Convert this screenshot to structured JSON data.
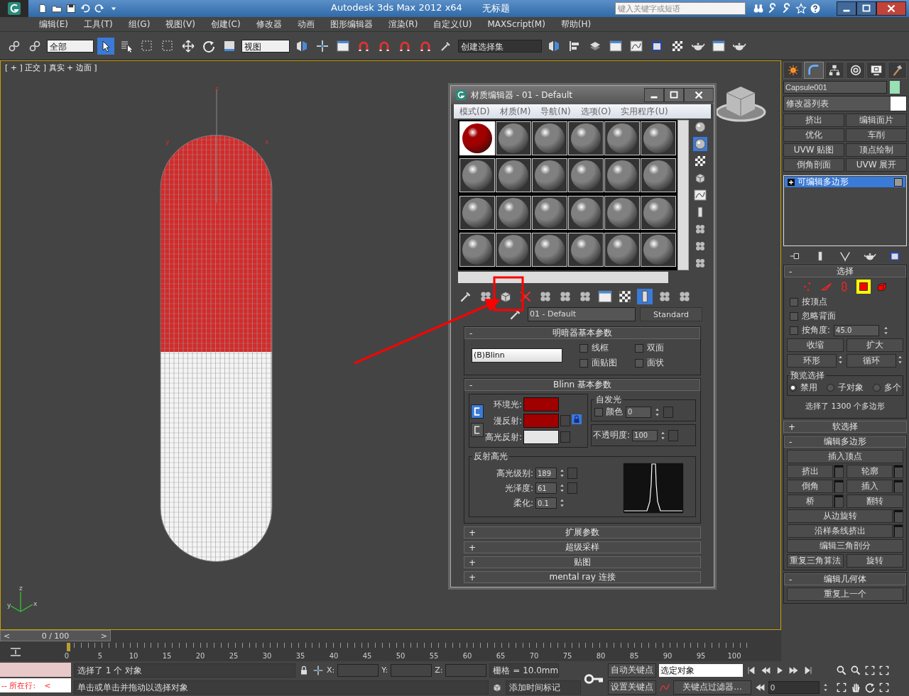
{
  "title_bar": {
    "app_title": "Autodesk 3ds Max  2012 x64",
    "document": "无标题",
    "search_placeholder": "键入关键字或短语"
  },
  "menu": [
    "编辑(E)",
    "工具(T)",
    "组(G)",
    "视图(V)",
    "创建(C)",
    "修改器",
    "动画",
    "图形编辑器",
    "渲染(R)",
    "自定义(U)",
    "MAXScript(M)",
    "帮助(H)"
  ],
  "main_toolbar": {
    "selection_filter": "全部",
    "reference_coord": "视图",
    "named_selection": "创建选择集"
  },
  "viewport": {
    "label": "[ + ] 正交 ] 真实 + 边面 ]",
    "object_axis_labels": [
      "z",
      "y",
      "x"
    ],
    "world_axis_labels": [
      "z",
      "y",
      "x"
    ]
  },
  "material_editor": {
    "title": "材质编辑器 - 01 - Default",
    "menu": [
      "模式(D)",
      "材质(M)",
      "导航(N)",
      "选项(O)",
      "实用程序(U)"
    ],
    "slots": [
      {
        "selected": true,
        "color": "#a00000"
      },
      {
        "selected": false,
        "color": "#808080"
      },
      {
        "selected": false,
        "color": "#808080"
      },
      {
        "selected": false,
        "color": "#808080"
      },
      {
        "selected": false,
        "color": "#808080"
      },
      {
        "selected": false,
        "color": "#808080"
      },
      {
        "selected": false,
        "color": "#808080"
      },
      {
        "selected": false,
        "color": "#808080"
      },
      {
        "selected": false,
        "color": "#808080"
      },
      {
        "selected": false,
        "color": "#808080"
      },
      {
        "selected": false,
        "color": "#808080"
      },
      {
        "selected": false,
        "color": "#808080"
      },
      {
        "selected": false,
        "color": "#808080"
      },
      {
        "selected": false,
        "color": "#808080"
      },
      {
        "selected": false,
        "color": "#808080"
      },
      {
        "selected": false,
        "color": "#808080"
      },
      {
        "selected": false,
        "color": "#808080"
      },
      {
        "selected": false,
        "color": "#808080"
      },
      {
        "selected": false,
        "color": "#808080"
      },
      {
        "selected": false,
        "color": "#808080"
      },
      {
        "selected": false,
        "color": "#808080"
      },
      {
        "selected": false,
        "color": "#808080"
      },
      {
        "selected": false,
        "color": "#808080"
      },
      {
        "selected": false,
        "color": "#808080"
      }
    ],
    "material_name": "01 - Default",
    "material_type": "Standard",
    "shader_rollout": {
      "sign": "-",
      "title": "明暗器基本参数",
      "shader": "(B)Blinn",
      "options": [
        {
          "label": "线框",
          "checked": false
        },
        {
          "label": "双面",
          "checked": false
        },
        {
          "label": "面贴图",
          "checked": false
        },
        {
          "label": "面状",
          "checked": false
        }
      ]
    },
    "blinn_rollout": {
      "sign": "-",
      "title": "Blinn 基本参数",
      "colors": [
        {
          "label": "环境光:",
          "color": "#a00000"
        },
        {
          "label": "漫反射:",
          "color": "#a00000"
        },
        {
          "label": "高光反射:",
          "color": "#e6e6e6"
        }
      ],
      "self_illum": {
        "title": "自发光",
        "label": "颜色",
        "checked": false,
        "value": "0"
      },
      "opacity": {
        "label": "不透明度:",
        "value": "100"
      },
      "highlights": {
        "title": "反射高光",
        "fields": [
          {
            "label": "高光级别:",
            "value": "189"
          },
          {
            "label": "光泽度:",
            "value": "61"
          },
          {
            "label": "柔化:",
            "value": "0.1"
          }
        ]
      }
    },
    "collapsed_rollouts": [
      {
        "sign": "+",
        "title": "扩展参数"
      },
      {
        "sign": "+",
        "title": "超级采样"
      },
      {
        "sign": "+",
        "title": "贴图"
      },
      {
        "sign": "+",
        "title": "mental ray 连接"
      }
    ]
  },
  "command_panel": {
    "tabs": [
      {
        "kind": "create",
        "selected": false
      },
      {
        "kind": "modify",
        "selected": true
      },
      {
        "kind": "hierarchy",
        "selected": false
      },
      {
        "kind": "motion",
        "selected": false
      },
      {
        "kind": "display",
        "selected": false
      },
      {
        "kind": "utilities",
        "selected": false
      }
    ],
    "object": {
      "name": "Capsule001",
      "color": "#99e0b4"
    },
    "modifier_list": "修改器列表",
    "modifier_buttons": [
      "挤出",
      "编辑面片",
      "优化",
      "车削",
      "UVW 贴图",
      "顶点绘制",
      "倒角剖面",
      "UVW 展开"
    ],
    "stack": [
      {
        "label": "可编辑多边形",
        "selected": true
      }
    ],
    "selection": {
      "sign": "-",
      "title": "选择",
      "levels": [
        {
          "kind": "vertex",
          "selected": false
        },
        {
          "kind": "edge",
          "selected": false
        },
        {
          "kind": "border",
          "selected": false
        },
        {
          "kind": "polygon",
          "selected": true
        },
        {
          "kind": "element",
          "selected": false
        }
      ],
      "options": [
        {
          "label": "按顶点",
          "checked": false
        },
        {
          "label": "忽略背面",
          "checked": false
        }
      ],
      "angle": {
        "label": "按角度:",
        "checked": false,
        "value": "45.0"
      },
      "buttons": [
        "收缩",
        "扩大"
      ],
      "spin_buttons": [
        "环形",
        "循环"
      ],
      "preview": {
        "title": "预览选择",
        "options": [
          {
            "label": "禁用",
            "selected": true
          },
          {
            "label": "子对象",
            "selected": false
          },
          {
            "label": "多个",
            "selected": false
          }
        ]
      },
      "info": "选择了 1300 个多边形"
    },
    "soft_selection": {
      "sign": "+",
      "title": "软选择"
    },
    "edit_polygons": {
      "sign": "-",
      "title": "编辑多边形",
      "rows": [
        [
          {
            "label": "插入顶点",
            "settings": false
          }
        ],
        [
          {
            "label": "挤出",
            "settings": true
          },
          {
            "label": "轮廓",
            "settings": true
          }
        ],
        [
          {
            "label": "倒角",
            "settings": true
          },
          {
            "label": "插入",
            "settings": true
          }
        ],
        [
          {
            "label": "桥",
            "settings": true
          },
          {
            "label": "翻转",
            "settings": false
          }
        ],
        [
          {
            "label": "从边旋转",
            "settings": true
          }
        ],
        [
          {
            "label": "沿样条线挤出",
            "settings": true
          }
        ],
        [
          {
            "label": "编辑三角剖分",
            "settings": false
          }
        ],
        [
          {
            "label": "重复三角算法",
            "settings": false
          },
          {
            "label": "旋转",
            "settings": false
          }
        ]
      ]
    },
    "edit_geometry": {
      "sign": "-",
      "title": "编辑几何体",
      "button": "重复上一个"
    }
  },
  "time_slider": {
    "prev": "<",
    "position": "0 / 100",
    "next": ">",
    "level": 0
  },
  "ruler_labels": [
    "0",
    "5",
    "10",
    "15",
    "20",
    "25",
    "30",
    "35",
    "40",
    "45",
    "50",
    "55",
    "60",
    "65",
    "70",
    "75",
    "80",
    "85",
    "90",
    "95",
    "100"
  ],
  "status_bar": {
    "line_label": "--  所在行:",
    "line_arrow": "<",
    "selection_info": "选择了 1 个 对象",
    "prompt": "单击或单击并拖动以选择对象",
    "axes": [
      "X:",
      "Y:",
      "Z:"
    ],
    "grid": "栅格 = 10.0mm",
    "time_tag": "添加时间标记",
    "auto_key": "自动关键点",
    "key_mode": "选定对象",
    "set_key": "设置关键点",
    "key_filters": "关键点过滤器...",
    "frame": "0"
  }
}
